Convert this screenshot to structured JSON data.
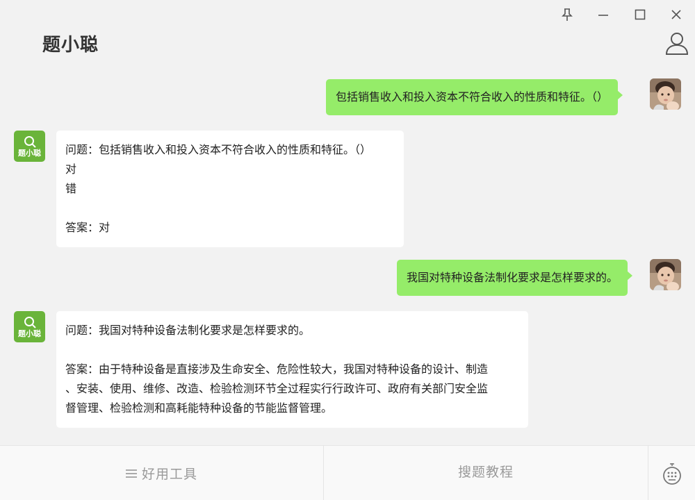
{
  "app": {
    "title": "题小聪"
  },
  "window_controls": [
    "pin-icon",
    "minimize-icon",
    "maximize-icon",
    "close-icon"
  ],
  "header": {
    "user_icon": "user-icon"
  },
  "bot": {
    "logo_text": "题小聪",
    "logo_icon": "magnifier-icon",
    "color": "#6ab43a"
  },
  "colors": {
    "user_bubble": "#95ec69",
    "bot_bubble": "#ffffff",
    "background": "#f2f2f2"
  },
  "messages": [
    {
      "from": "user",
      "text": "包括销售收入和投入资本不符合收入的性质和特征。（）"
    },
    {
      "from": "bot",
      "lines": [
        "问题：包括销售收入和投入资本不符合收入的性质和特征。（）",
        "对",
        "错",
        "",
        "答案：对"
      ]
    },
    {
      "from": "user",
      "text": "我国对特种设备法制化要求是怎样要求的。"
    },
    {
      "from": "bot",
      "lines": [
        "问题：我国对特种设备法制化要求是怎样要求的。",
        "",
        "答案：由于特种设备是直接涉及生命安全、危险性较大，我国对特种设备的设计、制造",
        "、安装、使用、维修、改造、检验检测环节全过程实行行政许可、政府有关部门安全监",
        "督管理、检验检测和高耗能特种设备的节能监督管理。"
      ]
    }
  ],
  "bottom": {
    "tools_label": "好用工具",
    "tools_icon": "menu-icon",
    "tutorial_label": "搜题教程",
    "right_icon": "keyboard-icon"
  }
}
